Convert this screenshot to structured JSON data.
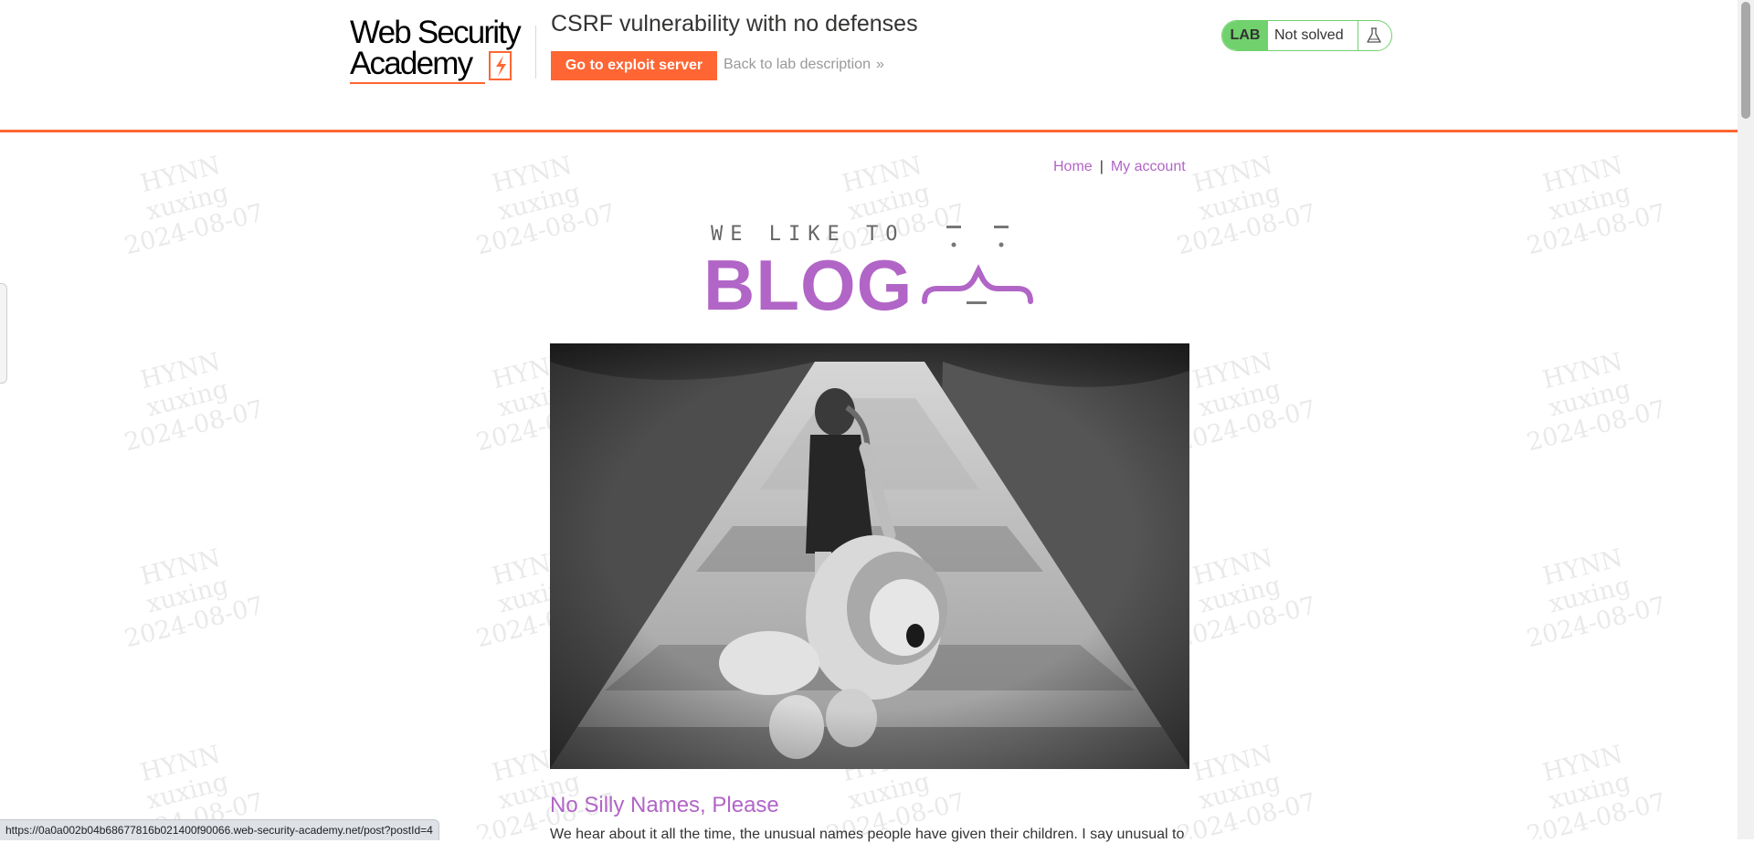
{
  "watermark": {
    "line1": "HYNN",
    "line2": "xuxing",
    "line3": "2024-08-07"
  },
  "header": {
    "logo_line1": "Web Security",
    "logo_line2": "Academy",
    "lab_title": "CSRF vulnerability with no defenses",
    "exploit_button": "Go to exploit server",
    "back_link": "Back to lab description",
    "back_chevron": "»",
    "lab_badge": "LAB",
    "lab_status": "Not solved",
    "status_color": "#70d16d",
    "accent_color": "#ff6633"
  },
  "nav": {
    "home": "Home",
    "separator": "|",
    "account": "My account",
    "link_color": "#b165c6"
  },
  "banner": {
    "small_text": "WE LIKE TO",
    "big_text": "BLOG"
  },
  "post": {
    "title": "No Silly Names, Please",
    "excerpt": "We hear about it all the time, the unusual names people have given their children. I say unusual to"
  },
  "statusbar": {
    "url": "https://0a0a002b04b68677816b021400f90066.web-security-academy.net/post?postId=4"
  }
}
